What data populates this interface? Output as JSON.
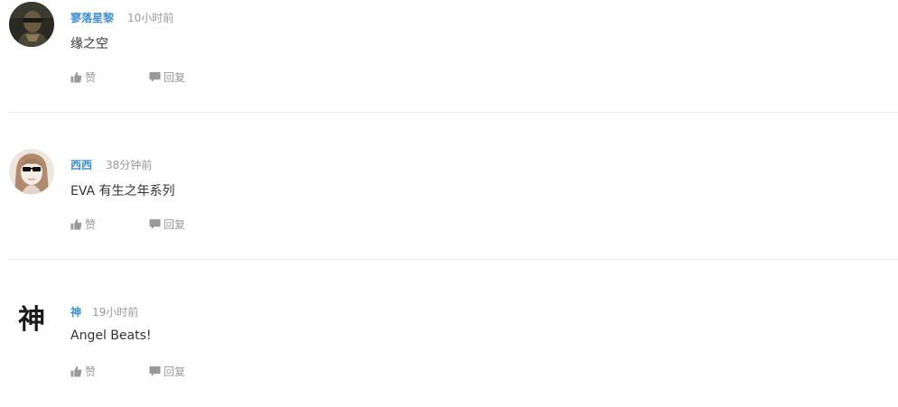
{
  "comments": [
    {
      "username": "寥落星黎",
      "time": "10小时前",
      "content": "缘之空",
      "like_label": "赞",
      "reply_label": "回复",
      "avatar_icon": "dark-photo-avatar"
    },
    {
      "username": "西西",
      "time": "38分钟前",
      "content": "EVA 有生之年系列",
      "like_label": "赞",
      "reply_label": "回复",
      "avatar_icon": "anime-girl-sunglasses-avatar"
    },
    {
      "username": "神",
      "time": "19小时前",
      "content": "Angel Beats!",
      "like_label": "赞",
      "reply_label": "回复",
      "avatar_icon": "kanji-avatar",
      "avatar_text": "神"
    }
  ],
  "colors": {
    "username": "#3e90d0",
    "meta_gray": "#999999",
    "text": "#333333",
    "divider": "#eaeaea"
  }
}
